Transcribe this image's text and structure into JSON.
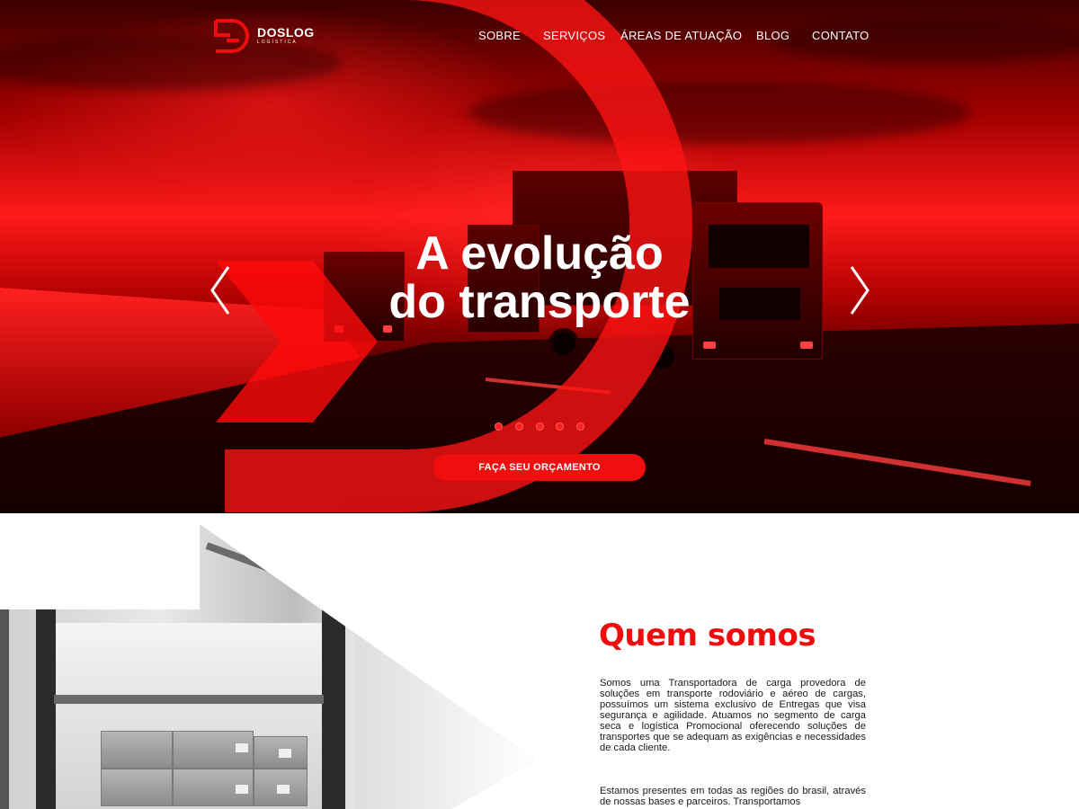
{
  "brand": {
    "name": "DOSLOG",
    "tagline": "LOGÍSTICA",
    "accent_color": "#ee0d0d"
  },
  "nav": {
    "items": [
      "SOBRE",
      "SERVIÇOS",
      "ÁREAS DE ATUAÇÃO",
      "BLOG",
      "CONTATO"
    ]
  },
  "hero": {
    "headline_line1": "A evolução",
    "headline_line2": "do transporte",
    "prev_icon": "chevron-left-icon",
    "next_icon": "chevron-right-icon",
    "slide_count": 5,
    "cta_label": "FAÇA SEU ORÇAMENTO"
  },
  "about": {
    "title": "Quem somos",
    "paragraph1": "Somos uma Transportadora de carga provedora de soluções em transporte rodoviário e aéreo de cargas, possuímos um sistema exclusivo de Entregas que visa segurança e agilidade. Atuamos no segmento de carga seca e logística Promocional oferecendo soluções de transportes que se adequam as exigências e necessidades de cada cliente.",
    "paragraph2": "Estamos presentes em todas as regiões do brasil, através de nossas bases e parceiros. Transportamos"
  }
}
